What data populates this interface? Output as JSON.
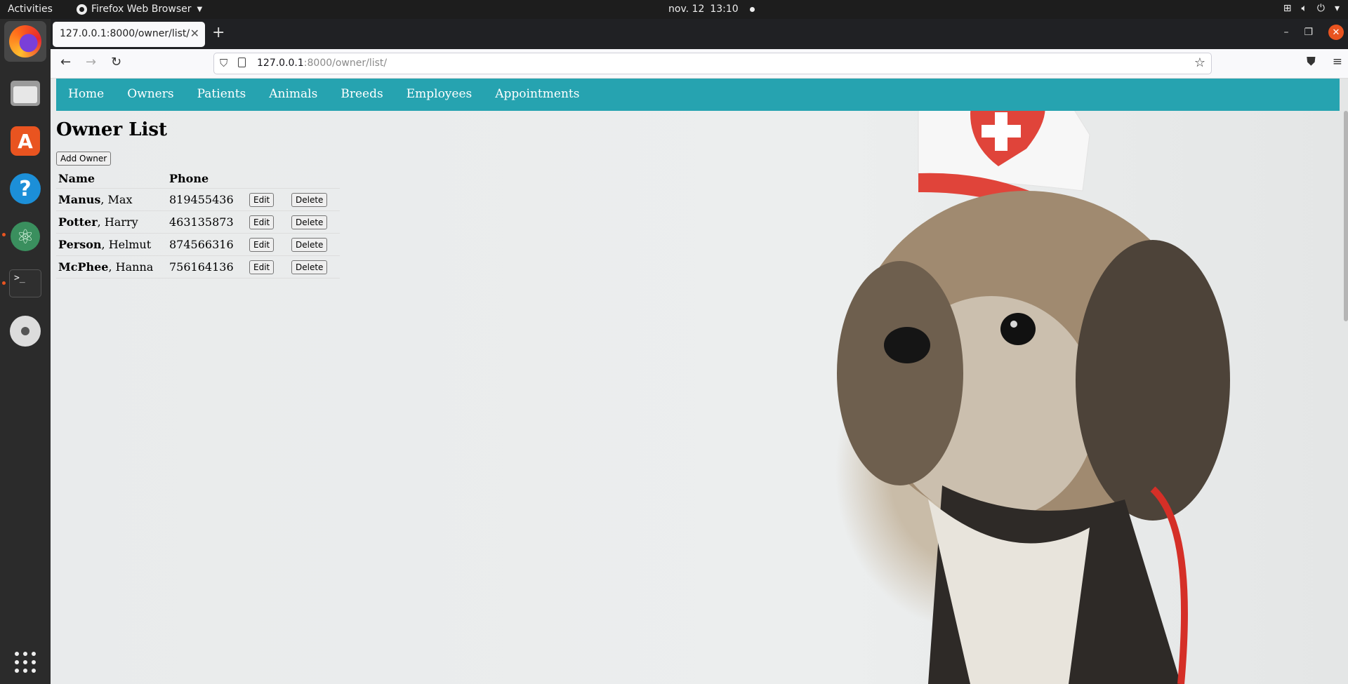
{
  "system": {
    "activities": "Activities",
    "app_name": "Firefox Web Browser",
    "date": "nov. 12",
    "time": "13:10"
  },
  "browser": {
    "tab_title": "127.0.0.1:8000/owner/list/",
    "url_host": "127.0.0.1",
    "url_rest": ":8000/owner/list/"
  },
  "site": {
    "nav": [
      "Home",
      "Owners",
      "Patients",
      "Animals",
      "Breeds",
      "Employees",
      "Appointments"
    ],
    "page_title": "Owner List",
    "add_button": "Add Owner",
    "columns": [
      "Name",
      "Phone"
    ],
    "edit_label": "Edit",
    "delete_label": "Delete",
    "owners": [
      {
        "last": "Manus",
        "first": ", Max",
        "phone": "819455436"
      },
      {
        "last": "Potter",
        "first": ", Harry",
        "phone": "463135873"
      },
      {
        "last": "Person",
        "first": ", Helmut",
        "phone": "874566316"
      },
      {
        "last": "McPhee",
        "first": ", Hanna",
        "phone": "756164136"
      }
    ]
  },
  "colors": {
    "nav_bg": "#26a3b0",
    "ubuntu_orange": "#e95420"
  }
}
